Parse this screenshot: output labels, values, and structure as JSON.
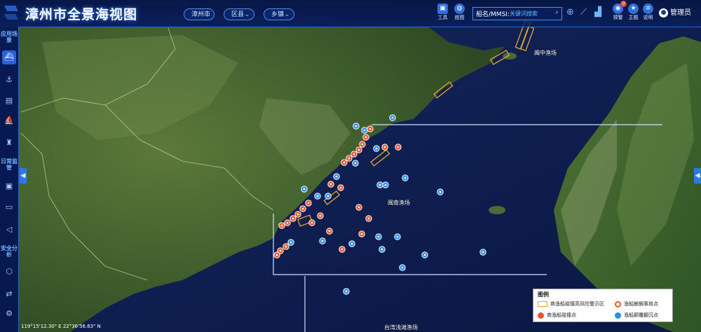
{
  "header": {
    "title": "漳州市全景海视图",
    "dropdowns": [
      {
        "label": "漳州市"
      },
      {
        "label": "区县"
      },
      {
        "label": "乡镇"
      }
    ],
    "search": {
      "label": "船名/MMSI:",
      "value": "关键词搜索"
    },
    "toolbar": [
      {
        "label": "工具"
      },
      {
        "label": "底图"
      }
    ],
    "right_icons": [
      {
        "label": "预警",
        "badge": "0"
      },
      {
        "label": "主题"
      },
      {
        "label": "说明"
      }
    ],
    "user": "管理员"
  },
  "sidebar": {
    "groups": [
      "应用场景",
      "日常监管",
      "安全分析"
    ]
  },
  "sea_labels": [
    "闽中渔场",
    "闽南渔场",
    "台湾浅滩渔场"
  ],
  "coords": "119°15'12.30\" E   22°36'56.63\" N",
  "legend": {
    "title": "图例",
    "items": [
      "商渔船碰撞高风险警示区",
      "渔船触搁事故点",
      "商渔船碰撞点",
      "渔船颠覆翻沉点"
    ]
  },
  "colors": {
    "accent": "#2f6fe0",
    "risk_zone": "#e8a52c",
    "collision_pin": "#e8552a",
    "capsize_pin": "#2a8ee8",
    "sea": "#0c1a4a"
  }
}
